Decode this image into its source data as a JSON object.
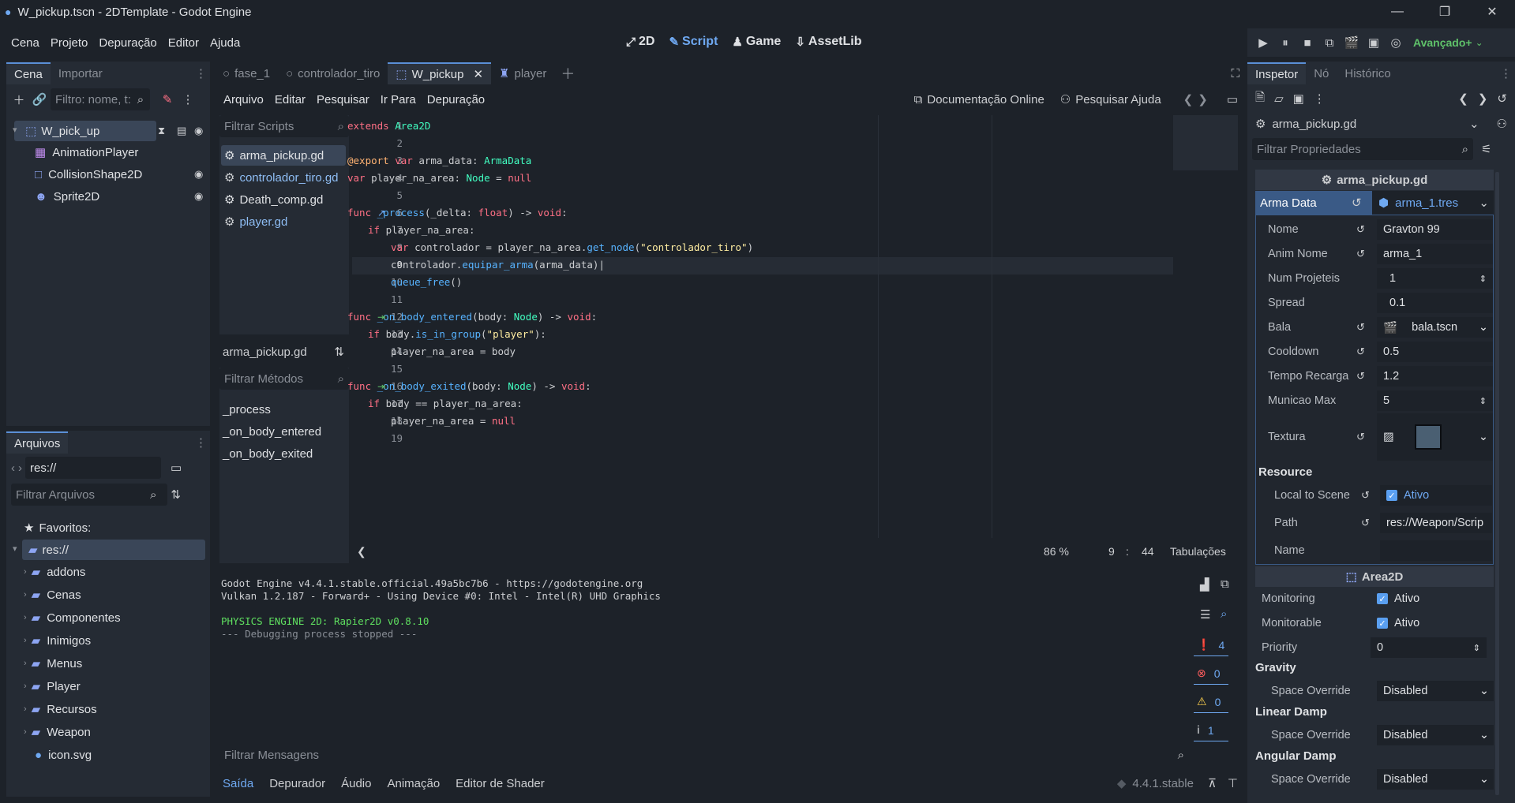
{
  "window": {
    "title": "W_pickup.tscn - 2DTemplate - Godot Engine",
    "min": "—",
    "max": "❐",
    "close": "✕"
  },
  "menubar": {
    "items": [
      "Cena",
      "Projeto",
      "Depuração",
      "Editor",
      "Ajuda"
    ],
    "workspaces": [
      {
        "icon": "⤢",
        "label": "2D"
      },
      {
        "icon": "✎",
        "label": "Script"
      },
      {
        "icon": "♟",
        "label": "Game"
      },
      {
        "icon": "⇩",
        "label": "AssetLib"
      }
    ],
    "renderer": "Avançado+"
  },
  "scene_dock": {
    "tabs": [
      "Cena",
      "Importar"
    ],
    "filter_placeholder": "Filtro: nome, t:",
    "nodes": [
      {
        "name": "W_pick_up",
        "icon": "area2d-icon"
      },
      {
        "name": "AnimationPlayer",
        "icon": "animation-player-icon"
      },
      {
        "name": "CollisionShape2D",
        "icon": "collision-shape-icon"
      },
      {
        "name": "Sprite2D",
        "icon": "sprite-icon"
      }
    ]
  },
  "filesystem": {
    "tab": "Arquivos",
    "path": "res://",
    "filter_placeholder": "Filtrar Arquivos",
    "favorites": "Favoritos:",
    "root": "res://",
    "folders": [
      "addons",
      "Cenas",
      "Componentes",
      "Inimigos",
      "Menus",
      "Player",
      "Recursos",
      "Weapon"
    ],
    "file": "icon.svg"
  },
  "editor_tabs": [
    "fase_1",
    "controlador_tiro",
    "W_pickup",
    "player"
  ],
  "script_menu": {
    "items": [
      "Arquivo",
      "Editar",
      "Pesquisar",
      "Ir Para",
      "Depuração"
    ],
    "online_docs": "Documentação Online",
    "search_help": "Pesquisar Ajuda"
  },
  "script_list": {
    "filter_placeholder": "Filtrar Scripts",
    "scripts": [
      "arma_pickup.gd",
      "controlador_tiro.gd",
      "Death_comp.gd",
      "player.gd"
    ],
    "current": "arma_pickup.gd",
    "methods_placeholder": "Filtrar Métodos",
    "methods": [
      "_process",
      "_on_body_entered",
      "_on_body_exited"
    ]
  },
  "code": {
    "line_numbers": [
      "1",
      "2",
      "3",
      "4",
      "5",
      "6",
      "7",
      "8",
      "9",
      "10",
      "11",
      "12",
      "13",
      "14",
      "15",
      "16",
      "17",
      "18",
      "19"
    ],
    "status": {
      "zoom": "86 %",
      "line": "9",
      "col": "44",
      "indent": "Tabulações"
    }
  },
  "output": {
    "lines": [
      "Godot Engine v4.4.1.stable.official.49a5bc7b6 - https://godotengine.org",
      "Vulkan 1.2.187 - Forward+ - Using Device #0: Intel - Intel(R) UHD Graphics",
      "",
      "PHYSICS ENGINE 2D: Rapier2D v0.8.10",
      "--- Debugging process stopped ---"
    ],
    "counts": {
      "messages": "4",
      "errors": "0",
      "warnings": "0",
      "info": "1"
    },
    "filter_placeholder": "Filtrar Mensagens",
    "bottom_tabs": [
      "Saída",
      "Depurador",
      "Áudio",
      "Animação",
      "Editor de Shader"
    ],
    "version": "4.4.1.stable"
  },
  "inspector": {
    "tabs": [
      "Inspetor",
      "Nó",
      "Histórico"
    ],
    "resource": "arma_pickup.gd",
    "filter_placeholder": "Filtrar Propriedades",
    "script_header": "arma_pickup.gd",
    "arma_data_label": "Arma Data",
    "arma_data_value": "arma_1.tres",
    "props": [
      {
        "label": "Nome",
        "value": "Gravton 99"
      },
      {
        "label": "Anim Nome",
        "value": "arma_1"
      },
      {
        "label": "Num Projeteis",
        "value": "1"
      },
      {
        "label": "Spread",
        "value": "0.1"
      },
      {
        "label": "Bala",
        "value": "bala.tscn"
      },
      {
        "label": "Cooldown",
        "value": "0.5"
      },
      {
        "label": "Tempo Recarga",
        "value": "1.2"
      },
      {
        "label": "Municao Max",
        "value": "5"
      },
      {
        "label": "Textura",
        "value": ""
      }
    ],
    "resource_section": "Resource",
    "local_to_scene": "Local to Scene",
    "ativo": "Ativo",
    "path_label": "Path",
    "path_value": "res://Weapon/Scrip",
    "name_label": "Name",
    "area_header": "Area2D",
    "monitoring": "Monitoring",
    "monitorable": "Monitorable",
    "priority_label": "Priority",
    "priority_value": "0",
    "gravity": "Gravity",
    "linear_damp": "Linear Damp",
    "angular_damp": "Angular Damp",
    "space_override": "Space Override",
    "disabled": "Disabled"
  },
  "colors": {
    "accent": "#6fa9f2",
    "bg": "#1d2229",
    "panel": "#252b34"
  }
}
